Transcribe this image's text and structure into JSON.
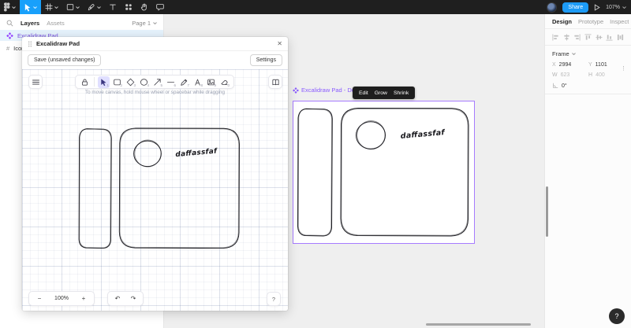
{
  "topbar": {
    "share_label": "Share",
    "zoom_value": "107%"
  },
  "sidebar": {
    "tabs": [
      {
        "label": "Layers"
      },
      {
        "label": "Assets"
      }
    ],
    "page_selector": "Page 1",
    "layers": [
      {
        "name": "Excalidraw Pad",
        "type": "widget",
        "selected": true
      },
      {
        "name": "Icon",
        "type": "frame"
      }
    ]
  },
  "modal": {
    "title": "Excalidraw Pad",
    "close_glyph": "✕",
    "save_button": "Save (unsaved changes)",
    "settings_button": "Settings",
    "hint": "To move canvas, hold mouse wheel or spacebar while dragging",
    "tools": [
      {
        "name": "lock"
      },
      {
        "name": "selection",
        "shortcut": "1",
        "active": true
      },
      {
        "name": "rectangle",
        "shortcut": "2"
      },
      {
        "name": "diamond",
        "shortcut": "3"
      },
      {
        "name": "ellipse",
        "shortcut": "4"
      },
      {
        "name": "arrow",
        "shortcut": "5"
      },
      {
        "name": "line",
        "shortcut": "6"
      },
      {
        "name": "draw",
        "shortcut": "7"
      },
      {
        "name": "text",
        "shortcut": "8"
      },
      {
        "name": "image",
        "shortcut": "9"
      },
      {
        "name": "eraser",
        "shortcut": "0"
      }
    ],
    "zoom_out_glyph": "−",
    "zoom_value": "100%",
    "zoom_in_glyph": "+",
    "undo_glyph": "↶",
    "redo_glyph": "↷",
    "help_glyph": "?",
    "drawing_text": "daffassfaf"
  },
  "canvas": {
    "frame_label": "Excalidraw Pad - Details",
    "drawing_text": "daffassfaf",
    "context_actions": [
      {
        "label": "Edit"
      },
      {
        "label": "Grow"
      },
      {
        "label": "Shrink"
      }
    ]
  },
  "right_panel": {
    "tabs": [
      {
        "label": "Design",
        "active": true
      },
      {
        "label": "Prototype"
      },
      {
        "label": "Inspect"
      }
    ],
    "section": "Frame",
    "fields": {
      "x": {
        "label": "X",
        "value": "2994"
      },
      "y": {
        "label": "Y",
        "value": "1101"
      },
      "w": {
        "label": "W",
        "value": "623",
        "disabled": true
      },
      "h": {
        "label": "H",
        "value": "400",
        "disabled": true
      },
      "rotation": {
        "value": "0°"
      }
    },
    "more_glyph": "⋮"
  },
  "help_button": "?",
  "colors": {
    "accent_blue": "#18a0fb",
    "widget_purple": "#8a5bff",
    "frame_selection_purple": "#a77bff",
    "toolbar_dark": "#1f1f1f",
    "selected_tool_bg": "#e0dfff"
  }
}
